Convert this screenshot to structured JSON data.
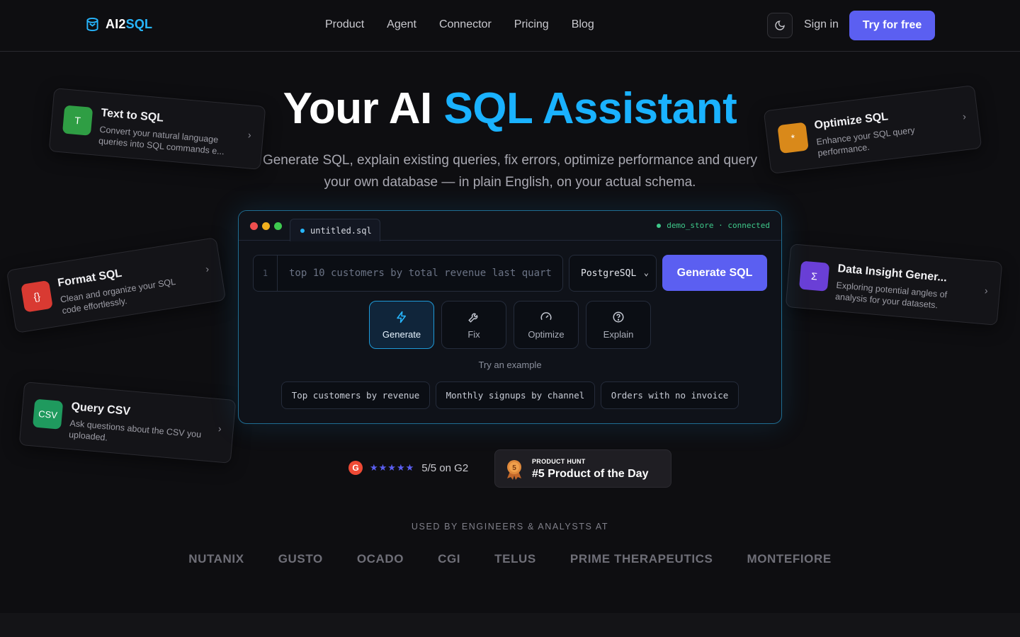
{
  "nav": {
    "brand": {
      "prefix": "AI2",
      "accent": "SQL"
    },
    "links": [
      "Product",
      "Agent",
      "Connector",
      "Pricing",
      "Blog"
    ],
    "theme_icon": "moon-icon",
    "signin": "Sign in",
    "cta": "Try for free"
  },
  "hero": {
    "title_plain": "Your AI ",
    "title_accent": "SQL Assistant",
    "subtitle": "Generate SQL, explain existing queries, fix errors, optimize performance and query your own database — in plain English, on your actual schema."
  },
  "cards": [
    {
      "title": "Text to SQL",
      "desc": "Convert your natural language queries into SQL commands e...",
      "icon": "T",
      "color": "#2f9e44"
    },
    {
      "title": "Optimize SQL",
      "desc": "Enhance your SQL query performance.",
      "icon": "*",
      "color": "#d9891a"
    },
    {
      "title": "Format SQL",
      "desc": "Clean and organize your SQL code effortlessly.",
      "icon": "{}",
      "color": "#d93a32"
    },
    {
      "title": "Data Insight Gener...",
      "desc": "Exploring potential angles of analysis for your datasets.",
      "icon": "Σ",
      "color": "#6a3fd6"
    },
    {
      "title": "Query CSV",
      "desc": "Ask questions about the CSV you uploaded.",
      "icon": "CSV",
      "color": "#1f9a5e"
    }
  ],
  "editor": {
    "tab": "untitled.sql",
    "status": "demo_store · connected",
    "line_no": "1",
    "query": "top 10 customers by total revenue last quart",
    "dialect": "PostgreSQL",
    "generate_btn": "Generate SQL",
    "modes": [
      {
        "label": "Generate",
        "icon": "bolt-icon",
        "active": true
      },
      {
        "label": "Fix",
        "icon": "wrench-icon",
        "active": false
      },
      {
        "label": "Optimize",
        "icon": "gauge-icon",
        "active": false
      },
      {
        "label": "Explain",
        "icon": "help-circle-icon",
        "active": false
      }
    ],
    "try_label": "Try an example",
    "examples": [
      "Top customers by revenue",
      "Monthly signups by channel",
      "Orders with no invoice"
    ]
  },
  "ratings": {
    "g2_logo": "G",
    "stars": "★★★★★",
    "g2_text": "5/5 on G2",
    "ph_kicker": "PRODUCT HUNT",
    "ph_medal": "5",
    "ph_title": "#5 Product of the Day"
  },
  "used_by": {
    "label": "USED BY ENGINEERS & ANALYSTS AT",
    "logos": [
      "NUTANIX",
      "GUSTO",
      "OCADO",
      "CGI",
      "TELUS",
      "PRIME THERAPEUTICS",
      "MONTEFIORE"
    ]
  }
}
